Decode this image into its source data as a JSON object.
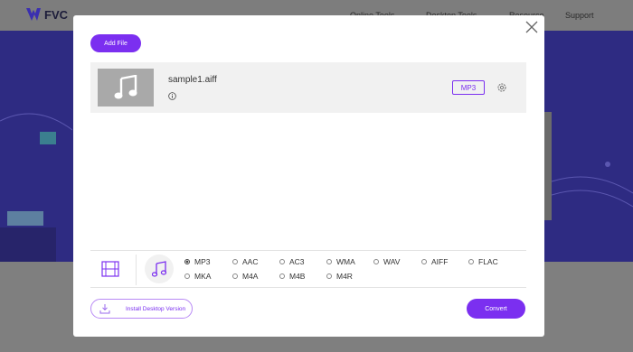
{
  "site": {
    "logo_text": "FVC",
    "nav": [
      "Online Tools",
      "Desktop Tools",
      "Resource",
      "Support"
    ]
  },
  "dialog": {
    "add_file_label": "Add File",
    "files": [
      {
        "name": "sample1.aiff",
        "format": "MP3"
      }
    ],
    "format_options": [
      "MP3",
      "AAC",
      "AC3",
      "WMA",
      "WAV",
      "AIFF",
      "FLAC",
      "MKA",
      "M4A",
      "M4B",
      "M4R"
    ],
    "selected_format": "MP3",
    "install_label": "Install Desktop Version",
    "convert_label": "Convert"
  },
  "colors": {
    "accent": "#7b2ff0",
    "hero_bg": "#2e2b82"
  }
}
